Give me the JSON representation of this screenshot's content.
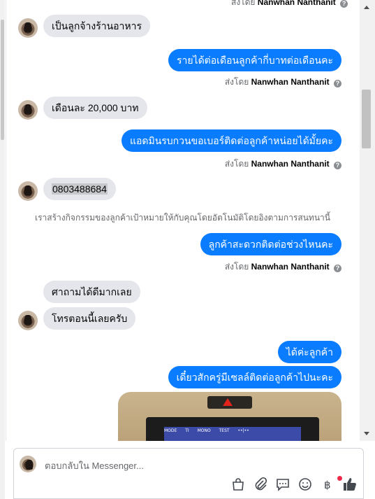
{
  "conversation": {
    "top_cut_caption": {
      "prefix": "ส่งโดย",
      "sender": "Nanwhan Nanthanit"
    },
    "messages": [
      {
        "id": "m1",
        "direction": "incoming",
        "text": "เป็นลูกจ้างร้านอาหาร"
      },
      {
        "id": "m2",
        "direction": "outgoing",
        "text": "รายได้ต่อเดือนลูกค้ากี่บาทต่อเดือนคะ",
        "sent_by_prefix": "ส่งโดย",
        "sent_by": "Nanwhan Nanthanit"
      },
      {
        "id": "m3",
        "direction": "incoming",
        "text": "เดือนละ 20,000 บาท"
      },
      {
        "id": "m4",
        "direction": "outgoing",
        "text": "แอดมินรบกวนขอเบอร์ติดต่อลูกค้าหน่อยได้มั้ยคะ",
        "sent_by_prefix": "ส่งโดย",
        "sent_by": "Nanwhan Nanthanit"
      },
      {
        "id": "m5",
        "direction": "incoming",
        "text": "0803488684"
      },
      {
        "id": "m6",
        "direction": "outgoing",
        "text": "ลูกค้าสะดวกติดต่อช่วงไหนคะ",
        "sent_by_prefix": "ส่งโดย",
        "sent_by": "Nanwhan Nanthanit"
      },
      {
        "id": "m7",
        "direction": "incoming",
        "text": "ศาถามได้ดีมากเลย"
      },
      {
        "id": "m8",
        "direction": "incoming",
        "text": "โทรตอนนี้เลยครับ"
      },
      {
        "id": "m9",
        "direction": "outgoing",
        "text": "ได้ค่ะลูกค้า"
      },
      {
        "id": "m10",
        "direction": "outgoing",
        "text": "เดี๋ยวสักครู่มีเซลล์ติดต่อลูกค้าไปนะคะ"
      }
    ],
    "system_notice": "เราสร้างกิจกรรมของลูกค้าเป้าหมายให้กับคุณโดยอัตโนมัติโดยอิงตามการสนทนานี้",
    "image_attachment": {
      "menu_items": [
        "MODE",
        "TI",
        "MONO",
        "TEST",
        "••|••"
      ]
    }
  },
  "composer": {
    "placeholder": "ตอบกลับใน Messenger...",
    "toolbar_icons": [
      "bag-icon",
      "attachment-icon",
      "chat-bubble-icon",
      "emoji-icon",
      "baht-icon",
      "like-icon"
    ]
  },
  "colors": {
    "outgoing_bubble": "#0a7cff",
    "incoming_bubble": "#e4e6eb",
    "notification_dot": "#f02849"
  }
}
